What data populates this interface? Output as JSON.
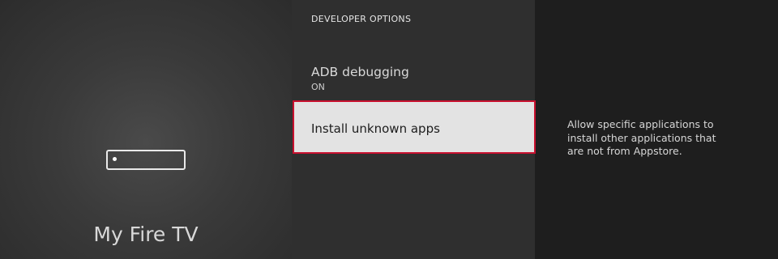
{
  "home": {
    "title": "My Fire TV"
  },
  "settings": {
    "section_title": "DEVELOPER OPTIONS",
    "items": [
      {
        "label": "ADB debugging",
        "value": "ON"
      },
      {
        "label": "Install unknown apps"
      }
    ],
    "description": "Allow specific applications to install other applications that are not from Appstore."
  },
  "icons": {
    "device": "fire-tv-device-icon"
  },
  "colors": {
    "focus_border": "#c8102e",
    "focus_background": "#e3e3e3"
  }
}
